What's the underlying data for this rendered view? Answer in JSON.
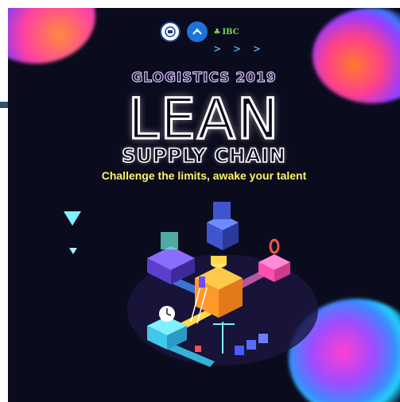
{
  "logos": {
    "logo_1_icon": "university-seal-icon",
    "logo_2_icon": "club-emblem-icon",
    "ibc_text": "IBC"
  },
  "chevrons": "> > >",
  "event_title": "GLOGISTICS 2019",
  "headline": "LEAN",
  "subheadline": "SUPPLY CHAIN",
  "tagline": "Challenge the limits, awake your talent",
  "colors": {
    "background": "#0b0b1e",
    "tagline": "#fff36a",
    "accent_cyan": "#7ef0ff",
    "accent_pink": "#ff3fa6"
  }
}
